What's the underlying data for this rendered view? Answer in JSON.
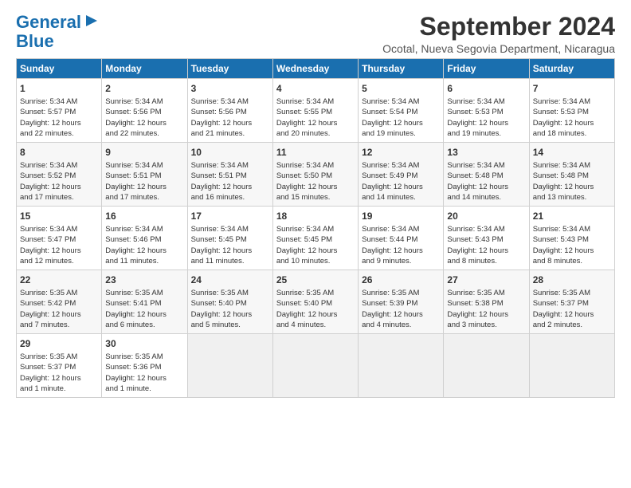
{
  "logo": {
    "line1": "General",
    "line2": "Blue",
    "arrow": true
  },
  "title": "September 2024",
  "location": "Ocotal, Nueva Segovia Department, Nicaragua",
  "days_header": [
    "Sunday",
    "Monday",
    "Tuesday",
    "Wednesday",
    "Thursday",
    "Friday",
    "Saturday"
  ],
  "weeks": [
    [
      {
        "day": "1",
        "lines": [
          "Sunrise: 5:34 AM",
          "Sunset: 5:57 PM",
          "Daylight: 12 hours",
          "and 22 minutes."
        ]
      },
      {
        "day": "2",
        "lines": [
          "Sunrise: 5:34 AM",
          "Sunset: 5:56 PM",
          "Daylight: 12 hours",
          "and 22 minutes."
        ]
      },
      {
        "day": "3",
        "lines": [
          "Sunrise: 5:34 AM",
          "Sunset: 5:56 PM",
          "Daylight: 12 hours",
          "and 21 minutes."
        ]
      },
      {
        "day": "4",
        "lines": [
          "Sunrise: 5:34 AM",
          "Sunset: 5:55 PM",
          "Daylight: 12 hours",
          "and 20 minutes."
        ]
      },
      {
        "day": "5",
        "lines": [
          "Sunrise: 5:34 AM",
          "Sunset: 5:54 PM",
          "Daylight: 12 hours",
          "and 19 minutes."
        ]
      },
      {
        "day": "6",
        "lines": [
          "Sunrise: 5:34 AM",
          "Sunset: 5:53 PM",
          "Daylight: 12 hours",
          "and 19 minutes."
        ]
      },
      {
        "day": "7",
        "lines": [
          "Sunrise: 5:34 AM",
          "Sunset: 5:53 PM",
          "Daylight: 12 hours",
          "and 18 minutes."
        ]
      }
    ],
    [
      {
        "day": "8",
        "lines": [
          "Sunrise: 5:34 AM",
          "Sunset: 5:52 PM",
          "Daylight: 12 hours",
          "and 17 minutes."
        ]
      },
      {
        "day": "9",
        "lines": [
          "Sunrise: 5:34 AM",
          "Sunset: 5:51 PM",
          "Daylight: 12 hours",
          "and 17 minutes."
        ]
      },
      {
        "day": "10",
        "lines": [
          "Sunrise: 5:34 AM",
          "Sunset: 5:51 PM",
          "Daylight: 12 hours",
          "and 16 minutes."
        ]
      },
      {
        "day": "11",
        "lines": [
          "Sunrise: 5:34 AM",
          "Sunset: 5:50 PM",
          "Daylight: 12 hours",
          "and 15 minutes."
        ]
      },
      {
        "day": "12",
        "lines": [
          "Sunrise: 5:34 AM",
          "Sunset: 5:49 PM",
          "Daylight: 12 hours",
          "and 14 minutes."
        ]
      },
      {
        "day": "13",
        "lines": [
          "Sunrise: 5:34 AM",
          "Sunset: 5:48 PM",
          "Daylight: 12 hours",
          "and 14 minutes."
        ]
      },
      {
        "day": "14",
        "lines": [
          "Sunrise: 5:34 AM",
          "Sunset: 5:48 PM",
          "Daylight: 12 hours",
          "and 13 minutes."
        ]
      }
    ],
    [
      {
        "day": "15",
        "lines": [
          "Sunrise: 5:34 AM",
          "Sunset: 5:47 PM",
          "Daylight: 12 hours",
          "and 12 minutes."
        ]
      },
      {
        "day": "16",
        "lines": [
          "Sunrise: 5:34 AM",
          "Sunset: 5:46 PM",
          "Daylight: 12 hours",
          "and 11 minutes."
        ]
      },
      {
        "day": "17",
        "lines": [
          "Sunrise: 5:34 AM",
          "Sunset: 5:45 PM",
          "Daylight: 12 hours",
          "and 11 minutes."
        ]
      },
      {
        "day": "18",
        "lines": [
          "Sunrise: 5:34 AM",
          "Sunset: 5:45 PM",
          "Daylight: 12 hours",
          "and 10 minutes."
        ]
      },
      {
        "day": "19",
        "lines": [
          "Sunrise: 5:34 AM",
          "Sunset: 5:44 PM",
          "Daylight: 12 hours",
          "and 9 minutes."
        ]
      },
      {
        "day": "20",
        "lines": [
          "Sunrise: 5:34 AM",
          "Sunset: 5:43 PM",
          "Daylight: 12 hours",
          "and 8 minutes."
        ]
      },
      {
        "day": "21",
        "lines": [
          "Sunrise: 5:34 AM",
          "Sunset: 5:43 PM",
          "Daylight: 12 hours",
          "and 8 minutes."
        ]
      }
    ],
    [
      {
        "day": "22",
        "lines": [
          "Sunrise: 5:35 AM",
          "Sunset: 5:42 PM",
          "Daylight: 12 hours",
          "and 7 minutes."
        ]
      },
      {
        "day": "23",
        "lines": [
          "Sunrise: 5:35 AM",
          "Sunset: 5:41 PM",
          "Daylight: 12 hours",
          "and 6 minutes."
        ]
      },
      {
        "day": "24",
        "lines": [
          "Sunrise: 5:35 AM",
          "Sunset: 5:40 PM",
          "Daylight: 12 hours",
          "and 5 minutes."
        ]
      },
      {
        "day": "25",
        "lines": [
          "Sunrise: 5:35 AM",
          "Sunset: 5:40 PM",
          "Daylight: 12 hours",
          "and 4 minutes."
        ]
      },
      {
        "day": "26",
        "lines": [
          "Sunrise: 5:35 AM",
          "Sunset: 5:39 PM",
          "Daylight: 12 hours",
          "and 4 minutes."
        ]
      },
      {
        "day": "27",
        "lines": [
          "Sunrise: 5:35 AM",
          "Sunset: 5:38 PM",
          "Daylight: 12 hours",
          "and 3 minutes."
        ]
      },
      {
        "day": "28",
        "lines": [
          "Sunrise: 5:35 AM",
          "Sunset: 5:37 PM",
          "Daylight: 12 hours",
          "and 2 minutes."
        ]
      }
    ],
    [
      {
        "day": "29",
        "lines": [
          "Sunrise: 5:35 AM",
          "Sunset: 5:37 PM",
          "Daylight: 12 hours",
          "and 1 minute."
        ]
      },
      {
        "day": "30",
        "lines": [
          "Sunrise: 5:35 AM",
          "Sunset: 5:36 PM",
          "Daylight: 12 hours",
          "and 1 minute."
        ]
      },
      {
        "day": "",
        "lines": []
      },
      {
        "day": "",
        "lines": []
      },
      {
        "day": "",
        "lines": []
      },
      {
        "day": "",
        "lines": []
      },
      {
        "day": "",
        "lines": []
      }
    ]
  ]
}
